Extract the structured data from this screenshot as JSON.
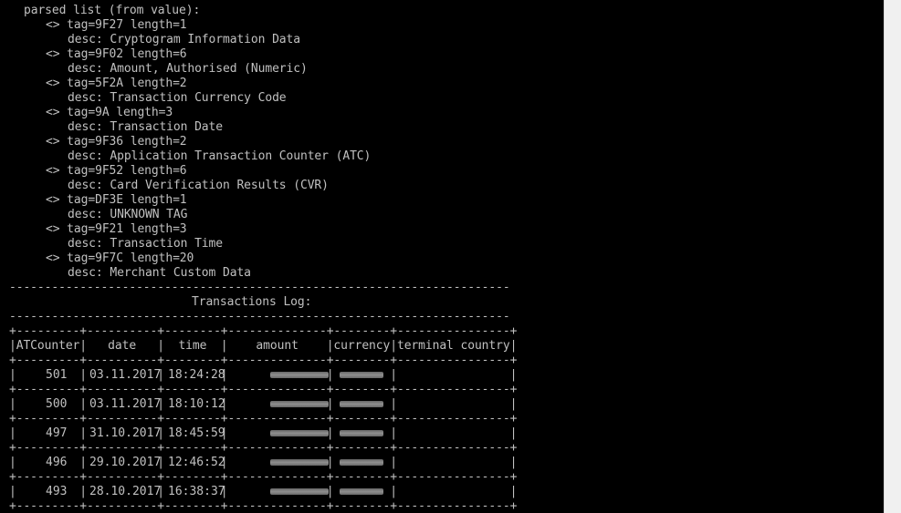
{
  "parsed": {
    "header": "parsed list (from value):",
    "entries": [
      {
        "tag": "<> tag=9F27 length=1",
        "desc": "desc: Cryptogram Information Data"
      },
      {
        "tag": "<> tag=9F02 length=6",
        "desc": "desc: Amount, Authorised (Numeric)"
      },
      {
        "tag": "<> tag=5F2A length=2",
        "desc": "desc: Transaction Currency Code"
      },
      {
        "tag": "<> tag=9A length=3",
        "desc": "desc: Transaction Date"
      },
      {
        "tag": "<> tag=9F36 length=2",
        "desc": "desc: Application Transaction Counter (ATC)"
      },
      {
        "tag": "<> tag=9F52 length=6",
        "desc": "desc: Card Verification Results (CVR)"
      },
      {
        "tag": "<> tag=DF3E length=1",
        "desc": "desc: UNKNOWN TAG"
      },
      {
        "tag": "<> tag=9F21 length=3",
        "desc": "desc: Transaction Time"
      },
      {
        "tag": "<> tag=9F7C length=20",
        "desc": "desc: Merchant Custom Data"
      }
    ]
  },
  "separator": "-----------------------------------------------------------------------",
  "log": {
    "title": "Transactions Log:",
    "border": "+---------+----------+--------+--------------+--------+----------------+",
    "header_row": "|ATCounter|   date   |  time  |    amount    |currency|terminal country|",
    "rows": [
      {
        "atc": "501",
        "date": "03.11.2017",
        "time": "18:24:28"
      },
      {
        "atc": "500",
        "date": "03.11.2017",
        "time": "18:10:12"
      },
      {
        "atc": "497",
        "date": "31.10.2017",
        "time": "18:45:59"
      },
      {
        "atc": "496",
        "date": "29.10.2017",
        "time": "12:46:52"
      },
      {
        "atc": "493",
        "date": "28.10.2017",
        "time": "16:38:37"
      }
    ]
  }
}
